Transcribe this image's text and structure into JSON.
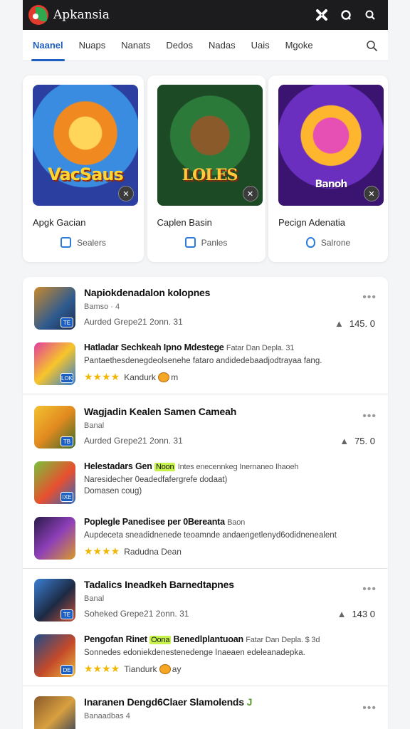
{
  "app": {
    "title": "Apkansia"
  },
  "tabs": [
    {
      "label": "Naanel",
      "active": true
    },
    {
      "label": "Nuaps"
    },
    {
      "label": "Nanats"
    },
    {
      "label": "Dedos"
    },
    {
      "label": "Nadas"
    },
    {
      "label": "Uais"
    },
    {
      "label": "Mgoke"
    }
  ],
  "cards": [
    {
      "art_text": "VacSaus",
      "title": "Apgk Gacian",
      "action": "Sealers"
    },
    {
      "art_text": "LOLES",
      "title": "Caplen Basin",
      "action": "Panles"
    },
    {
      "art_text": "Banoh",
      "title": "Pecign Adenatia",
      "action": "Salrone"
    }
  ],
  "groups": [
    {
      "name": "Napiokdenadalon kolopnes",
      "sub": "Bamso · 4",
      "meta": "Aurded Grepe21 2onn. 31",
      "score": "145. 0",
      "badge": "TE",
      "entries": [
        {
          "title": "Hatladar Sechkeah Ipno Mdestege",
          "rest": "Fatar Dan Depla. 31",
          "desc": "Pantaethesdenegdeolsenehe fataro andidedebaadjodtrayaa fang.",
          "rating_label": "Kandurk",
          "rating_suffix": "m",
          "stars": "★★★★",
          "badge": "LOK"
        }
      ]
    },
    {
      "name": "Wagjadin Kealen Samen Cameah",
      "sub": "Banal",
      "meta": "Aurded Grepe21 2onn. 31",
      "score": "75. 0",
      "badge": "TB",
      "entries": [
        {
          "title": "Helestadars Gen",
          "highlight": "Noon",
          "rest": "Intes enecennkeg Inernaneo Ihaoeh",
          "desc": "Naresidecher 0eadedfafergrefe dodaat)\nDomasen coug)",
          "badge": "IXE"
        },
        {
          "title": "Poplegle Panedisee per 0Bereanta",
          "rest": "Baon",
          "desc": "Aupdeceta sneadidnenede teoamnde andaengetlenyd6odidnenealent",
          "rating_label": "Radudna Dean",
          "stars": "★★★★"
        }
      ]
    },
    {
      "name": "Tadalics Ineadkeh Barnedtapnes",
      "sub": "Banal",
      "meta": "Soheked Grepe21 2onn. 31",
      "score": "143 0",
      "badge": "TE",
      "entries": [
        {
          "title": "Pengofan Rinet",
          "highlight": "Oona",
          "after_highlight": "Benedlplantuoan",
          "rest": "Fatar Dan Depla. $ 3d",
          "desc": "Sonnedes edoniekdenestenedenge Inaeaen edeleanadepka.",
          "rating_label": "Tiandurk",
          "rating_suffix": "ay",
          "stars": "★★★★",
          "badge": "DE"
        }
      ]
    },
    {
      "name": "Inaranen Dengd6Claer Slamolends",
      "name_suffix": "J",
      "sub": "Banaadbas 4"
    }
  ],
  "colors": {
    "accent": "#1f5fbf",
    "appbar": "#1c1c1e",
    "star": "#f2b705"
  }
}
